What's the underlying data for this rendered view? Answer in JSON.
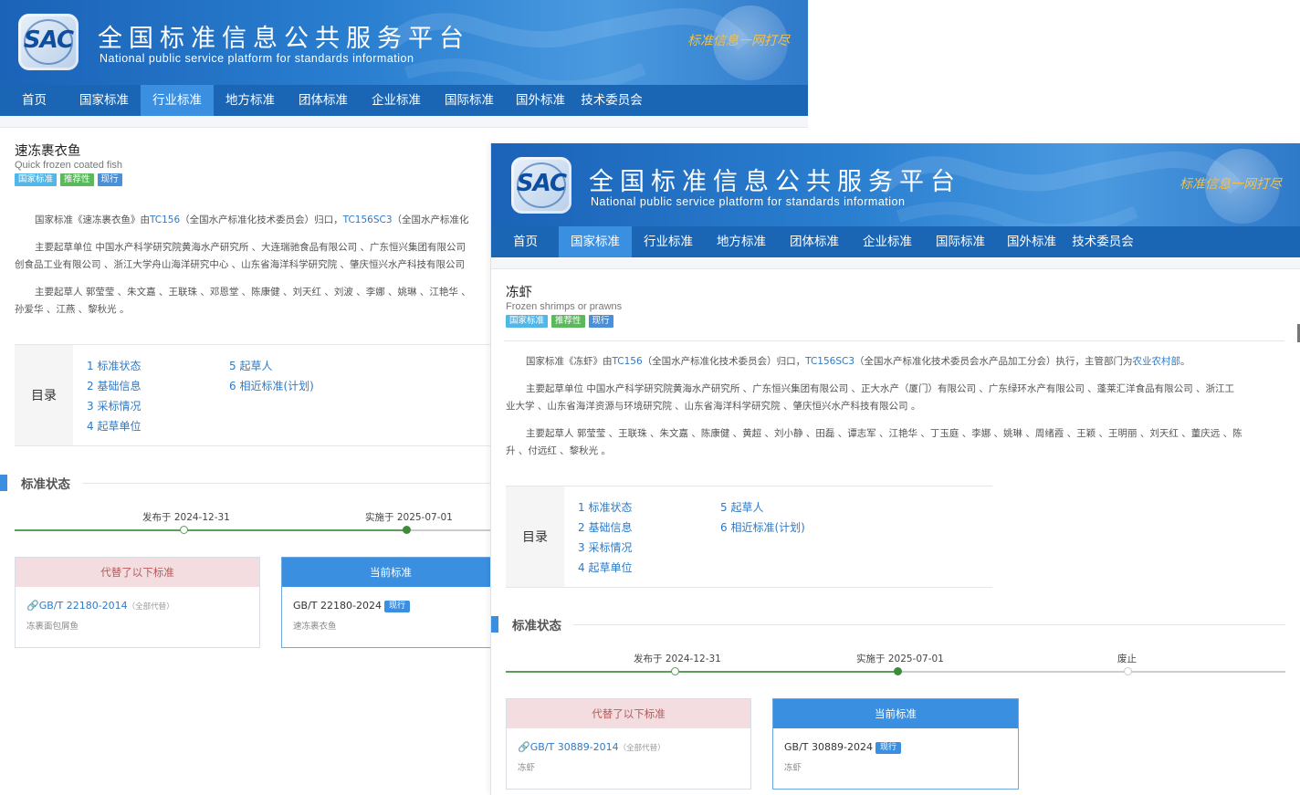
{
  "site": {
    "title": "全国标准信息公共服务平台",
    "subtitle": "National public service platform  for standards information",
    "logo_text": "SAC",
    "slogan": "标准信息一网打尽"
  },
  "nav": [
    "首页",
    "国家标准",
    "行业标准",
    "地方标准",
    "团体标准",
    "企业标准",
    "国际标准",
    "国外标准",
    "技术委员会"
  ],
  "colors": {
    "nav_bg": "#1a66b5",
    "nav_active": "#3a8fe0",
    "link": "#2f7ac6",
    "badge_national": "#52b6e8",
    "badge_recommended": "#5cb85c",
    "badge_current": "#4a8fd9"
  },
  "back": {
    "active_nav": 2,
    "title": "速冻裹衣鱼",
    "title_en": "Quick frozen coated fish",
    "badges": [
      "国家标准",
      "推荐性",
      "现行"
    ],
    "p1_pre": "国家标准《速冻裹衣鱼》由",
    "p1_tc": "TC156",
    "p1_mid": "（全国水产标准化技术委员会）归口，",
    "p1_sc": "TC156SC3",
    "p1_post": "（全国水产标准化",
    "p2_line1": "主要起草单位 中国水产科学研究院黄海水产研究所 、大连瑞驰食品有限公司 、广东恒兴集团有限公司",
    "p2_line2": "创食品工业有限公司 、浙江大学舟山海洋研究中心 、山东省海洋科学研究院 、肇庆恒兴水产科技有限公司",
    "p3_line1": "主要起草人 郭莹莹 、朱文嘉 、王联珠 、邓恩堂 、陈康健 、刘天红 、刘波 、李娜 、姚琳 、江艳华 、",
    "p3_line2": "孙爱华 、江燕 、黎秋光 。",
    "toc_label": "目录",
    "toc": [
      "1  标准状态",
      "2  基础信息",
      "3  采标情况",
      "4  起草单位",
      "5  起草人",
      "6  相近标准(计划)"
    ],
    "section_title": "标准状态",
    "publish": "发布于 2024-12-31",
    "implement": "实施于 2025-07-01",
    "replaced_head": "代替了以下标准",
    "current_head": "当前标准",
    "replaced_code": "GB/T 22180-2014",
    "replaced_note": "（全部代替）",
    "replaced_name": "冻裹面包屑鱼",
    "current_code": "GB/T 22180-2024",
    "current_tag": "现行",
    "current_name": "速冻裹衣鱼"
  },
  "front": {
    "active_nav": 1,
    "title": "冻虾",
    "title_en": "Frozen shrimps or prawns",
    "badges": [
      "国家标准",
      "推荐性",
      "现行"
    ],
    "p1_pre": "国家标准《冻虾》由",
    "p1_tc": "TC156",
    "p1_mid": "（全国水产标准化技术委员会）归口，",
    "p1_sc": "TC156SC3",
    "p1_post": "（全国水产标准化技术委员会水产品加工分会）执行，主管部门为",
    "p1_dept": "农业农村部",
    "p1_end": "。",
    "p2_line1": "主要起草单位 中国水产科学研究院黄海水产研究所 、广东恒兴集团有限公司 、正大水产（厦门）有限公司 、广东绿环水产有限公司 、蓬莱汇洋食品有限公司 、浙江工",
    "p2_line2": "业大学 、山东省海洋资源与环境研究院 、山东省海洋科学研究院 、肇庆恒兴水产科技有限公司 。",
    "p3_line1": "主要起草人 郭莹莹 、王联珠 、朱文嘉 、陈康健 、黄超 、刘小静 、田磊 、谭志军 、江艳华 、丁玉庭 、李娜 、姚琳 、周绪霞 、王颖 、王明丽 、刘天红 、董庆远 、陈",
    "p3_line2": "升 、付远红 、黎秋光 。",
    "toc_label": "目录",
    "toc": [
      "1  标准状态",
      "2  基础信息",
      "3  采标情况",
      "4  起草单位",
      "5  起草人",
      "6  相近标准(计划)"
    ],
    "section_title": "标准状态",
    "publish": "发布于 2024-12-31",
    "implement": "实施于 2025-07-01",
    "abolish": "废止",
    "replaced_head": "代替了以下标准",
    "current_head": "当前标准",
    "replaced_code": "GB/T 30889-2014",
    "replaced_note": "（全部代替）",
    "replaced_name": "冻虾",
    "current_code": "GB/T 30889-2024",
    "current_tag": "现行",
    "current_name": "冻虾"
  }
}
